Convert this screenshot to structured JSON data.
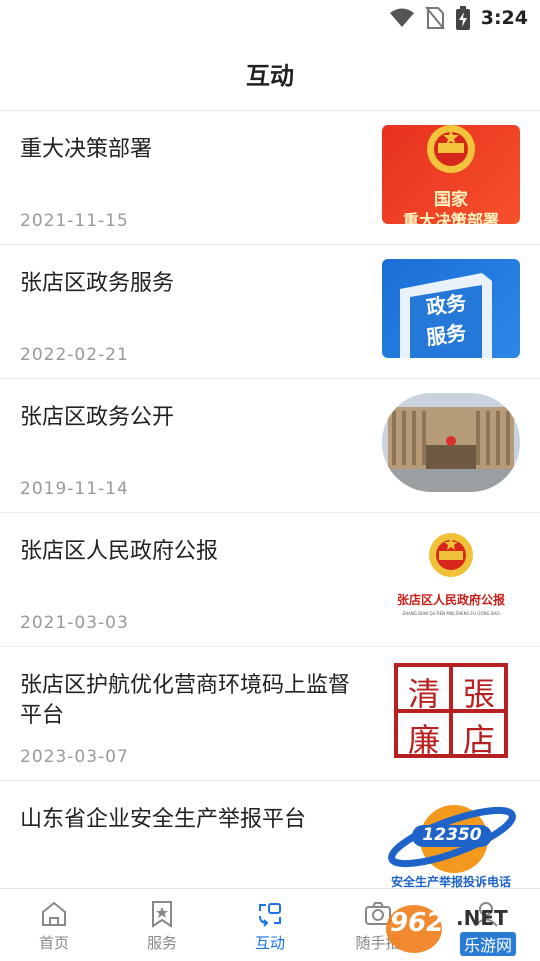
{
  "status": {
    "time": "3:24"
  },
  "header": {
    "title": "互动"
  },
  "items": [
    {
      "title": "重大决策部署",
      "date": "2021-11-15",
      "thumb_text_1": "国家",
      "thumb_text_2": "重大决策部署"
    },
    {
      "title": "张店区政务服务",
      "date": "2022-02-21",
      "thumb_text_1": "政务",
      "thumb_text_2": "服务"
    },
    {
      "title": "张店区政务公开",
      "date": "2019-11-14"
    },
    {
      "title": "张店区人民政府公报",
      "date": "2021-03-03",
      "thumb_text_1": "张店区人民政府公报",
      "thumb_text_2": "ZHANG DIAN QU REN MIN ZHENG FU GONG BAO"
    },
    {
      "title": "张店区护航优化营商环境码上监督平台",
      "date": "2023-03-07",
      "thumb_text_1": "清",
      "thumb_text_2": "張",
      "thumb_text_3": "廉",
      "thumb_text_4": "店"
    },
    {
      "title": "山东省企业安全生产举报平台",
      "date": "",
      "thumb_text_1": "12350",
      "thumb_text_2": "安全生产举报投诉电话"
    }
  ],
  "tabs": [
    {
      "label": "首页",
      "icon": "home-icon"
    },
    {
      "label": "服务",
      "icon": "star-bookmark-icon"
    },
    {
      "label": "互动",
      "icon": "interaction-icon",
      "active": true
    },
    {
      "label": "随手拍",
      "icon": "camera-icon"
    },
    {
      "label": "",
      "icon": "person-icon"
    }
  ],
  "watermark": {
    "text_1": "962",
    "text_2": ".NET",
    "text_3": "乐游网"
  },
  "colors": {
    "accent": "#1a73e8",
    "title": "#222222",
    "date": "#999999"
  }
}
